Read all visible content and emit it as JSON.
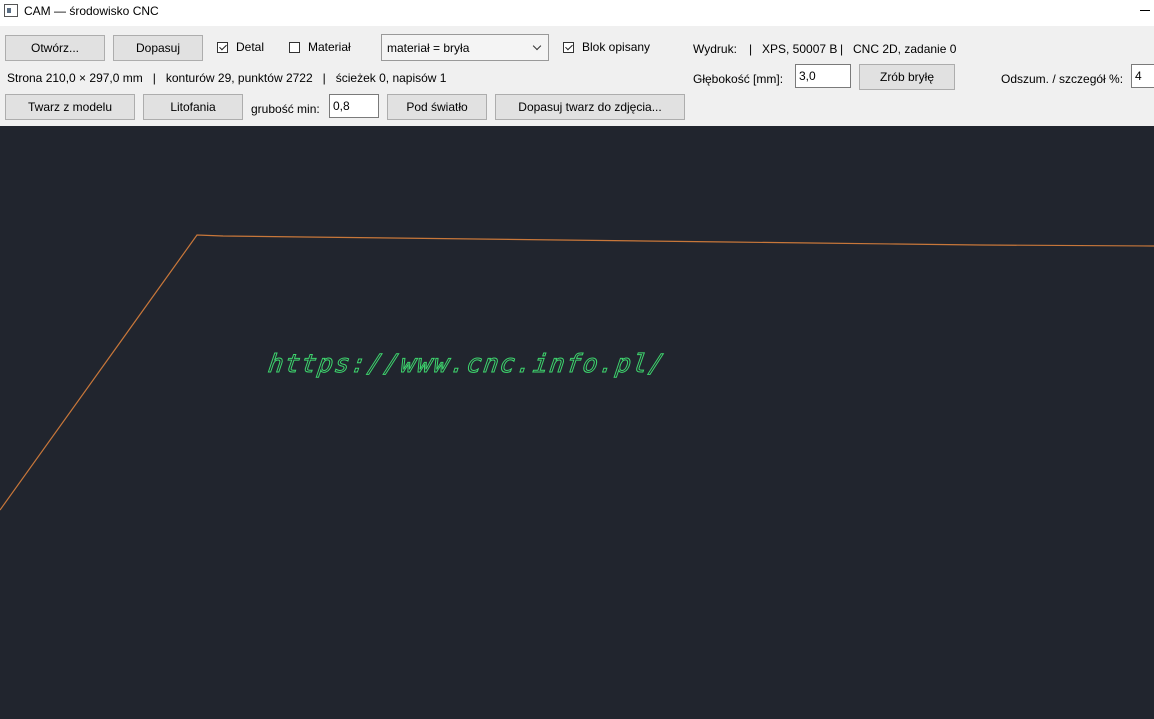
{
  "window": {
    "title": "CAM — środowisko CNC"
  },
  "toolbar": {
    "open_label": "Otwórz...",
    "fit_label": "Dopasuj",
    "detail_label": "Detal",
    "detail_checked": true,
    "material_label": "Materiał",
    "material_checked": false,
    "material_select_value": "materiał = bryła",
    "block_described_label": "Blok opisany",
    "block_described_checked": true,
    "print_label": "Wydruk:",
    "sep1": "|",
    "print_info": "XPS, 50007 B",
    "sep2": "|",
    "mode_info": "CNC 2D, zadanie 0",
    "page_info": "Strona 210,0 × 297,0 mm   |   konturów 29, punktów 2722   |   ścieżek 0, napisów 1",
    "depth_label": "Głębokość [mm]:",
    "depth_value": "3,0",
    "make_solid_label": "Zrób bryłę",
    "denoise_label": "Odszum. / szczegół %:",
    "denoise_value": "4",
    "face_from_model_label": "Twarz z modelu",
    "lithophane_label": "Litofania",
    "min_thickness_label": "grubość min:",
    "min_thickness_value": "0,8",
    "backlight_label": "Pod światło",
    "fit_face_label": "Dopasuj twarz do zdjęcia..."
  },
  "canvas": {
    "background": "#21252e",
    "contour_color": "#c8773a",
    "text_color": "#3ed66e",
    "text": "https://www.cnc.info.pl/"
  }
}
